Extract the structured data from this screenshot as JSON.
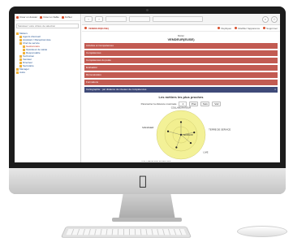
{
  "window": {
    "title": "Cartographie par distance de niveaux de compétences"
  },
  "sidebar": {
    "toolbar": [
      {
        "icon": "new-doc-icon",
        "label": "Créer un dossier"
      },
      {
        "icon": "new-file-icon",
        "label": "Créer un fiable"
      },
      {
        "icon": "delete-icon",
        "label": "Fichier"
      }
    ],
    "search_placeholder": "Saisissez votre critère de sélection",
    "tree": [
      {
        "label": "Métiers",
        "level": 0
      },
      {
        "label": "Agents d'accueil",
        "level": 1
      },
      {
        "label": "Assistant / Réceptionniste",
        "level": 1
      },
      {
        "label": "Chef de service",
        "level": 1
      },
      {
        "label": "Gestionnaire",
        "level": 2
      },
      {
        "label": "Opérateur de saisie",
        "level": 2
      },
      {
        "label": "Responsable",
        "level": 2
      },
      {
        "label": "Technicien",
        "level": 1
      },
      {
        "label": "Vendeur",
        "level": 1
      },
      {
        "label": "Directeur",
        "level": 1
      },
      {
        "label": "Secrétaire",
        "level": 1
      },
      {
        "label": "Manager",
        "level": 0
      },
      {
        "label": "Autre",
        "level": 0
      }
    ],
    "highlighted_index": 4
  },
  "topbar": {
    "back": "‹",
    "forward": "›",
    "breadcrumb_1": "",
    "breadcrumb_2": "",
    "breadcrumb_3": "",
    "search_icon": "search-icon",
    "user_icon": "user-icon"
  },
  "subbar": {
    "record_name": "VENDEUR(EUSE)",
    "actions": [
      {
        "label": "Dupliquer"
      },
      {
        "label": "Modifier l'apparence"
      },
      {
        "label": "Supprimer"
      }
    ]
  },
  "record": {
    "type_label": "Métier",
    "title": "VENDEUR(EUSE)"
  },
  "sections": [
    {
      "label": "Activités et Compétences"
    },
    {
      "label": "Compétences"
    },
    {
      "label": "Compétences du poste"
    },
    {
      "label": "Evaluation"
    },
    {
      "label": "Rémunération"
    },
    {
      "label": "Formations"
    }
  ],
  "active_section": {
    "label": "Cartographie : par distance de niveaux de compétences",
    "toggle": "×"
  },
  "cartography": {
    "title": "Les métiers les plus proches",
    "distance_label": "Paramétrer la distance maximale",
    "distance_value": "2",
    "buttons": [
      "Prec",
      "Suiv",
      "Voir"
    ]
  },
  "radar": {
    "center_label": "VENDEUR",
    "labels": [
      "COLLABORATEUR",
      "TERRE DE SERVICE",
      "LIVE",
      "COLLABORATEUR PROJET",
      "MANAGER"
    ],
    "rings": 3,
    "fill_color": "#f2ef8c",
    "stroke_color": "#c9c46a"
  }
}
